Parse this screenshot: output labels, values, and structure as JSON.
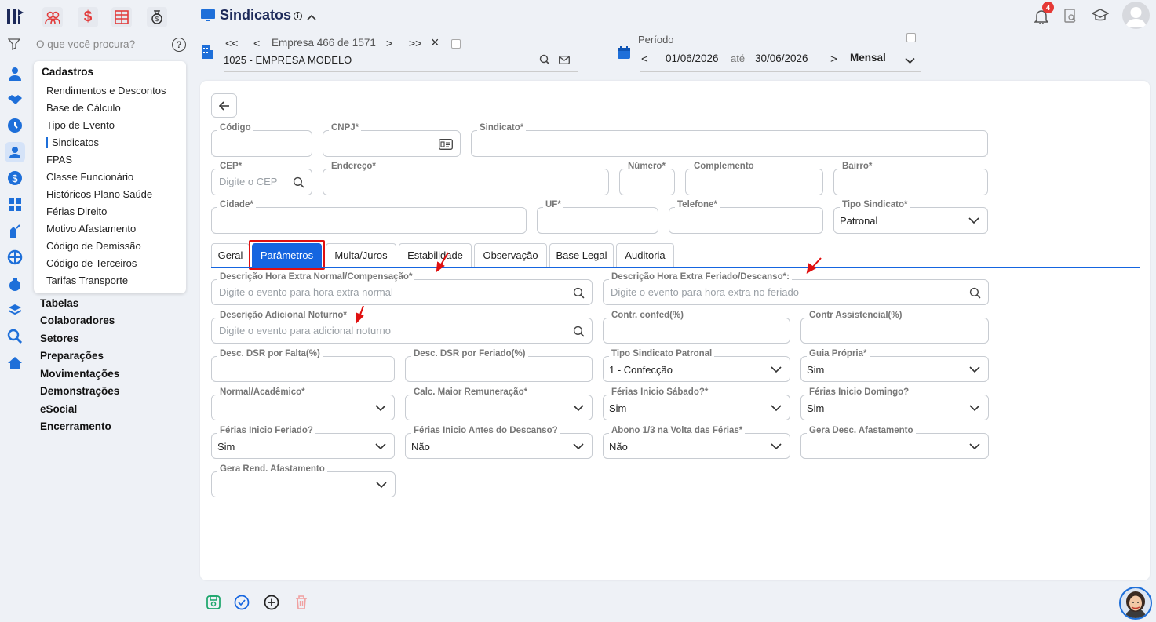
{
  "header": {
    "title": "Sindicatos",
    "search_placeholder": "O que você procura?",
    "notification_count": "4"
  },
  "company_nav": {
    "first": "<<",
    "prev": "<",
    "label": "Empresa 466 de 1571",
    "next": ">",
    "last": ">>",
    "close": "×",
    "company": "1025 - EMPRESA MODELO"
  },
  "period": {
    "label": "Período",
    "start": "01/06/2026",
    "sep": "até",
    "end": "30/06/2026",
    "mode": "Mensal"
  },
  "menu": {
    "cadastros": "Cadastros",
    "items": [
      "Rendimentos e Descontos",
      "Base de Cálculo",
      "Tipo de Evento",
      "Sindicatos",
      "FPAS",
      "Classe Funcionário",
      "Históricos Plano Saúde",
      "Férias Direito",
      "Motivo Afastamento",
      "Código de Demissão",
      "Código de Terceiros",
      "Tarifas Transporte"
    ],
    "sections": [
      "Tabelas",
      "Colaboradores",
      "Setores",
      "Preparações",
      "Movimentações",
      "Demonstrações",
      "eSocial",
      "Encerramento"
    ]
  },
  "form": {
    "codigo": {
      "label": "Código",
      "value": ""
    },
    "cnpj": {
      "label": "CNPJ*",
      "value": ""
    },
    "sindicato": {
      "label": "Sindicato*",
      "value": ""
    },
    "cep": {
      "label": "CEP*",
      "placeholder": "Digite o CEP"
    },
    "endereco": {
      "label": "Endereço*",
      "value": ""
    },
    "numero": {
      "label": "Número*",
      "value": ""
    },
    "complemento": {
      "label": "Complemento",
      "value": ""
    },
    "bairro": {
      "label": "Bairro*",
      "value": ""
    },
    "cidade": {
      "label": "Cidade*",
      "value": ""
    },
    "uf": {
      "label": "UF*",
      "value": ""
    },
    "telefone": {
      "label": "Telefone*",
      "value": ""
    },
    "tipo_sindicato": {
      "label": "Tipo Sindicato*",
      "value": "Patronal"
    }
  },
  "tabs": [
    "Geral",
    "Parâmetros",
    "Multa/Juros",
    "Estabilidade",
    "Observação",
    "Base Legal",
    "Auditoria"
  ],
  "params": {
    "he_normal": {
      "label": "Descrição Hora Extra Normal/Compensação*",
      "placeholder": "Digite o evento para hora extra normal"
    },
    "he_feriado": {
      "label": "Descrição Hora Extra Feriado/Descanso*:",
      "placeholder": "Digite o evento para hora extra no feriado"
    },
    "adic_noturno": {
      "label": "Descrição Adicional Noturno*",
      "placeholder": "Digite o evento para adicional noturno"
    },
    "contr_confed": {
      "label": "Contr. confed(%)",
      "value": ""
    },
    "contr_assist": {
      "label": "Contr Assistencial(%)",
      "value": ""
    },
    "dsr_falta": {
      "label": "Desc. DSR por Falta(%)",
      "value": ""
    },
    "dsr_feriado": {
      "label": "Desc. DSR por Feriado(%)",
      "value": ""
    },
    "tipo_patronal": {
      "label": "Tipo Sindicato Patronal",
      "value": "1 - Confecção"
    },
    "guia_propria": {
      "label": "Guia Própria*",
      "value": "Sim"
    },
    "normal_academico": {
      "label": "Normal/Acadêmico*",
      "value": ""
    },
    "calc_maior": {
      "label": "Calc. Maior Remuneração*",
      "value": ""
    },
    "ferias_sabado": {
      "label": "Férias Inicio Sábado?*",
      "value": "Sim"
    },
    "ferias_domingo": {
      "label": "Férias Inicio Domingo?",
      "value": "Sim"
    },
    "ferias_feriado": {
      "label": "Férias Inicio Feriado?",
      "value": "Sim"
    },
    "ferias_antes": {
      "label": "Férias Inicio Antes do Descanso?",
      "value": "Não"
    },
    "abono": {
      "label": "Abono 1/3 na Volta das Férias*",
      "value": "Não"
    },
    "gera_desc": {
      "label": "Gera Desc. Afastamento",
      "value": ""
    },
    "gera_rend": {
      "label": "Gera Rend. Afastamento",
      "value": ""
    }
  },
  "colors": {
    "accent": "#1565e0",
    "highlight": "#e01010",
    "rail_icon": "#1e6fd9"
  }
}
